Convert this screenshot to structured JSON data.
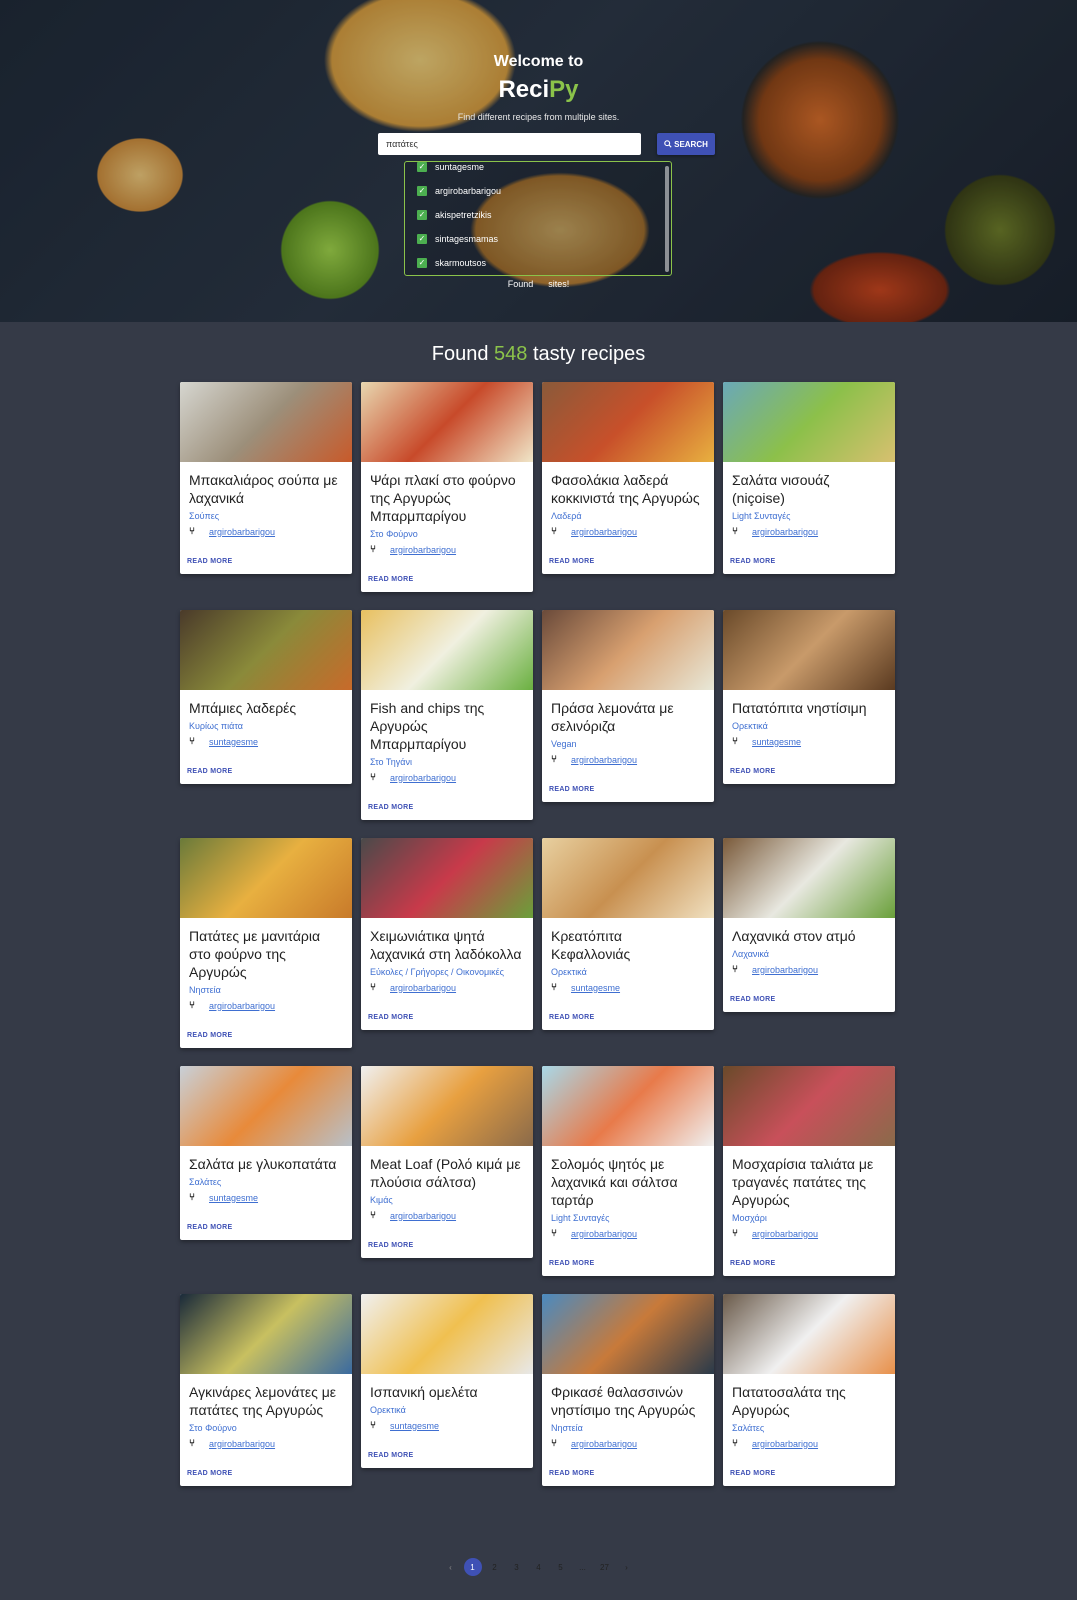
{
  "hero": {
    "title": "Welcome to",
    "logo_part1": "Reci",
    "logo_part2": "Py",
    "subtitle": "Find different recipes from multiple sites.",
    "search_value": "πατάτες",
    "search_button": "SEARCH",
    "sites": [
      "suntagesme",
      "argirobarbarigou",
      "akispetretzikis",
      "sintagesmamas",
      "skarmoutsos"
    ],
    "found_sites_prefix": "Found",
    "found_sites_suffix": "sites!"
  },
  "results": {
    "found_prefix": "Found",
    "count": "548",
    "found_suffix": "tasty recipes"
  },
  "recipes": [
    {
      "title": "Μπακαλιάρος σούπα με λαχανικά",
      "category": "Σούπες",
      "source": "argirobarbarigou"
    },
    {
      "title": "Ψάρι πλακί στο φούρνο της Αργυρώς Μπαρμπαρίγου",
      "category": "Στο Φούρνο",
      "source": "argirobarbarigou"
    },
    {
      "title": "Φασολάκια λαδερά κοκκινιστά της Αργυρώς",
      "category": "Λαδερά",
      "source": "argirobarbarigou"
    },
    {
      "title": "Σαλάτα νισουάζ (niçoise)",
      "category": "Light Συνταγές",
      "source": "argirobarbarigou"
    },
    {
      "title": "Μπάμιες λαδερές",
      "category": "Κυρίως πιάτα",
      "source": "suntagesme"
    },
    {
      "title": "Fish and chips της Αργυρώς Μπαρμπαρίγου",
      "category": "Στο Τηγάνι",
      "source": "argirobarbarigou"
    },
    {
      "title": "Πράσα λεμονάτα με σελινόριζα",
      "category": "Vegan",
      "source": "argirobarbarigou"
    },
    {
      "title": "Πατατόπιτα νηστίσιμη",
      "category": "Ορεκτικά",
      "source": "suntagesme"
    },
    {
      "title": "Πατάτες με μανιτάρια στο φούρνο της Αργυρώς",
      "category": "Νηστεία",
      "source": "argirobarbarigou"
    },
    {
      "title": "Χειμωνιάτικα ψητά λαχανικά στη λαδόκολλα",
      "category": "Εύκολες / Γρήγορες / Οικονομικές",
      "source": "argirobarbarigou"
    },
    {
      "title": "Κρεατόπιτα Κεφαλλονιάς",
      "category": "Ορεκτικά",
      "source": "suntagesme"
    },
    {
      "title": "Λαχανικά στον ατμό",
      "category": "Λαχανικά",
      "source": "argirobarbarigou"
    },
    {
      "title": "Σαλάτα με γλυκοπατάτα",
      "category": "Σαλάτες",
      "source": "suntagesme"
    },
    {
      "title": "Meat Loaf (Ρολό κιμά με πλούσια σάλτσα)",
      "category": "Κιμάς",
      "source": "argirobarbarigou"
    },
    {
      "title": "Σολομός ψητός με λαχανικά και σάλτσα ταρτάρ",
      "category": "Light Συνταγές",
      "source": "argirobarbarigou"
    },
    {
      "title": "Μοσχαρίσια ταλιάτα με τραγανές πατάτες της Αργυρώς",
      "category": "Μοσχάρι",
      "source": "argirobarbarigou"
    },
    {
      "title": "Αγκινάρες λεμονάτες με πατάτες της Αργυρώς",
      "category": "Στο Φούρνο",
      "source": "argirobarbarigou"
    },
    {
      "title": "Ισπανική ομελέτα",
      "category": "Ορεκτικά",
      "source": "suntagesme"
    },
    {
      "title": "Φρικασέ θαλασσινών νηστίσιμο της Αργυρώς",
      "category": "Νηστεία",
      "source": "argirobarbarigou"
    },
    {
      "title": "Πατατοσαλάτα της Αργυρώς",
      "category": "Σαλάτες",
      "source": "argirobarbarigou"
    }
  ],
  "read_more": "READ MORE",
  "pagination": {
    "prev": "‹",
    "pages": [
      "1",
      "2",
      "3",
      "4",
      "5",
      "...",
      "27"
    ],
    "active": "1",
    "next": "›"
  },
  "colors": {
    "accent": "#3f51b5",
    "brand_green": "#8bc34a",
    "background": "#353a47",
    "link": "#3f6fd1"
  }
}
